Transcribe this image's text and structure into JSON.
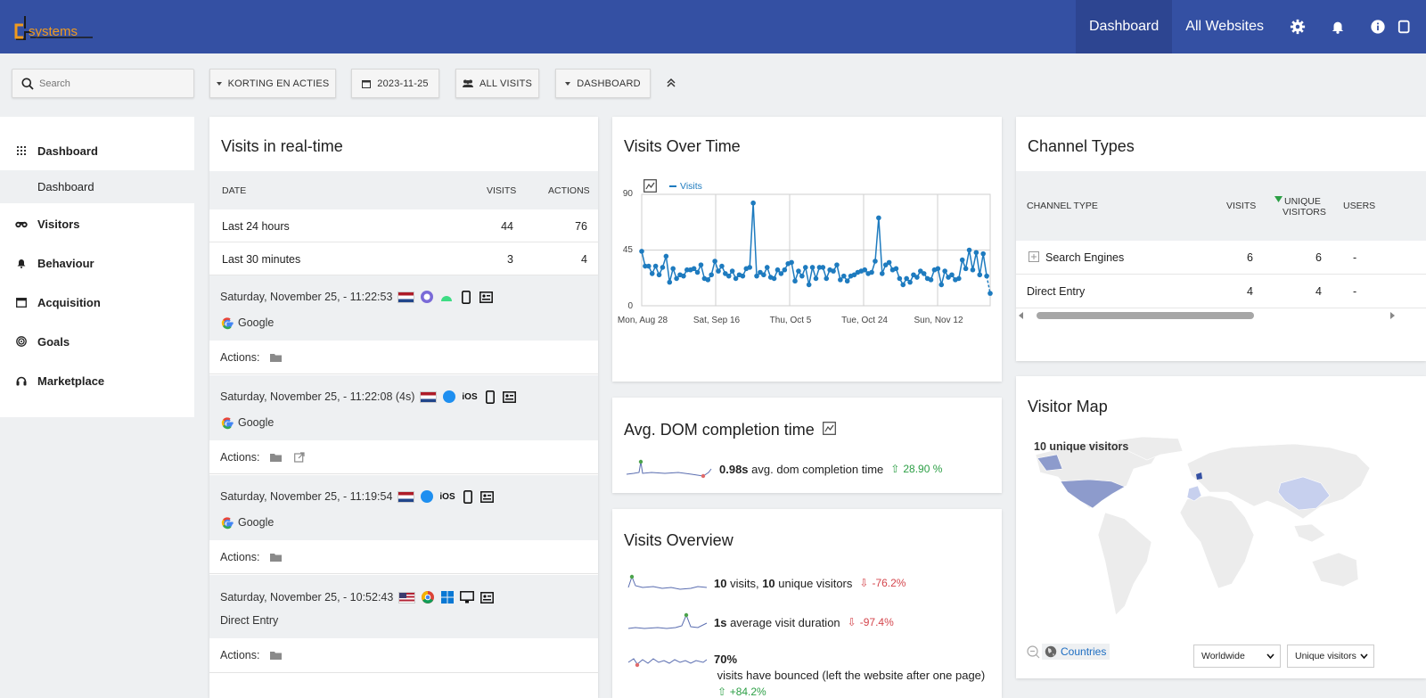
{
  "brand": {
    "logo_text": "systems"
  },
  "topnav": {
    "dashboard": "Dashboard",
    "all_websites": "All Websites"
  },
  "filters": {
    "search_placeholder": "Search",
    "segment": "KORTING EN ACTIES",
    "date": "2023-11-25",
    "visits": "ALL VISITS",
    "dashboard": "DASHBOARD"
  },
  "sidebar": {
    "items": [
      {
        "label": "Dashboard",
        "icon": "grid-icon"
      },
      {
        "label": "Visitors",
        "icon": "binoculars-icon"
      },
      {
        "label": "Behaviour",
        "icon": "bell-icon"
      },
      {
        "label": "Acquisition",
        "icon": "window-icon"
      },
      {
        "label": "Goals",
        "icon": "target-icon"
      },
      {
        "label": "Marketplace",
        "icon": "headset-icon"
      }
    ],
    "sub_dashboard": "Dashboard"
  },
  "realtime": {
    "title": "Visits in real-time",
    "col_date": "DATE",
    "col_visits": "VISITS",
    "col_actions": "ACTIONS",
    "rows": [
      {
        "label": "Last 24 hours",
        "visits": "44",
        "actions": "76"
      },
      {
        "label": "Last 30 minutes",
        "visits": "3",
        "actions": "4"
      }
    ],
    "actions_label": "Actions:",
    "visits_list": [
      {
        "time": "Saturday, November 25, - 11:22:53",
        "referrer": "Google"
      },
      {
        "time": "Saturday, November 25, - 11:22:08 (4s)",
        "os": "iOS",
        "referrer": "Google"
      },
      {
        "time": "Saturday, November 25, - 11:19:54",
        "os": "iOS",
        "referrer": "Google"
      },
      {
        "time": "Saturday, November 25, - 10:52:43",
        "referrer": "Direct Entry"
      }
    ]
  },
  "visits_over_time": {
    "title": "Visits Over Time",
    "legend": "Visits",
    "y_ticks": [
      "90",
      "45",
      "0"
    ],
    "x_ticks": [
      "Mon, Aug 28",
      "Sat, Sep 16",
      "Thu, Oct 5",
      "Tue, Oct 24",
      "Sun, Nov 12"
    ]
  },
  "chart_data": {
    "type": "line",
    "title": "Visits Over Time",
    "series": [
      {
        "name": "Visits",
        "values": [
          44,
          32,
          32,
          26,
          32,
          25,
          31,
          40,
          19,
          30,
          22,
          25,
          24,
          29,
          29,
          30,
          27,
          33,
          22,
          21,
          25,
          36,
          28,
          32,
          26,
          24,
          28,
          22,
          25,
          24,
          30,
          31,
          83,
          24,
          27,
          25,
          31,
          23,
          22,
          29,
          26,
          29,
          34,
          35,
          20,
          28,
          24,
          31,
          17,
          31,
          22,
          31,
          31,
          22,
          29,
          28,
          33,
          21,
          24,
          20,
          24,
          25,
          27,
          28,
          29,
          26,
          27,
          36,
          71,
          26,
          33,
          35,
          29,
          30,
          22,
          17,
          22,
          19,
          25,
          23,
          28,
          26,
          22,
          21,
          29,
          30,
          17,
          28,
          23,
          25,
          21,
          22,
          37,
          30,
          45,
          29,
          43,
          25,
          42,
          24,
          10
        ]
      }
    ],
    "ylim": [
      0,
      90
    ],
    "x_tick_labels": [
      "Mon, Aug 28",
      "Sat, Sep 16",
      "Thu, Oct 5",
      "Tue, Oct 24",
      "Sun, Nov 12"
    ]
  },
  "dom": {
    "title": "Avg. DOM completion time",
    "value": "0.98s",
    "label": " avg. dom completion time",
    "change": "28.90 %"
  },
  "overview": {
    "title": "Visits Overview",
    "rows": [
      {
        "strong1": "10",
        "text1": " visits, ",
        "strong2": "10",
        "text2": " unique visitors",
        "change": "-76.2%"
      },
      {
        "strong1": "1s",
        "text1": " average visit duration",
        "change": "-97.4%"
      },
      {
        "strong1": "70%",
        "text1": " visits have bounced (left the website after one page)",
        "change": "+84.2%"
      }
    ]
  },
  "channels": {
    "title": "Channel Types",
    "col_type": "CHANNEL TYPE",
    "col_visits": "VISITS",
    "col_unique_1": "UNIQUE",
    "col_unique_2": "VISITORS",
    "col_users": "USERS",
    "rows": [
      {
        "type": "Search Engines",
        "visits": "6",
        "unique": "6",
        "users": "-"
      },
      {
        "type": "Direct Entry",
        "visits": "4",
        "unique": "4",
        "users": "-"
      }
    ]
  },
  "map": {
    "title": "Visitor Map",
    "summary": "10 unique visitors",
    "countries_link": "Countries",
    "region_select": "Worldwide",
    "metric_select": "Unique visitors"
  }
}
